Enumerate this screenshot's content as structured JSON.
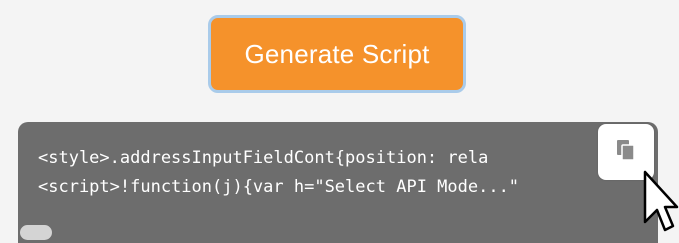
{
  "generate_button": {
    "label": "Generate Script"
  },
  "code_output": {
    "lines": [
      "<style>.addressInputFieldCont{position: rela",
      "<script>!function(j){var h=\"Select API Mode...\""
    ]
  },
  "copy_button": {
    "icon": "copy-icon"
  },
  "colors": {
    "button_bg": "#f5922b",
    "button_border": "#a9cbea",
    "code_bg": "#6d6d6d",
    "page_bg": "#f4f4f4"
  }
}
